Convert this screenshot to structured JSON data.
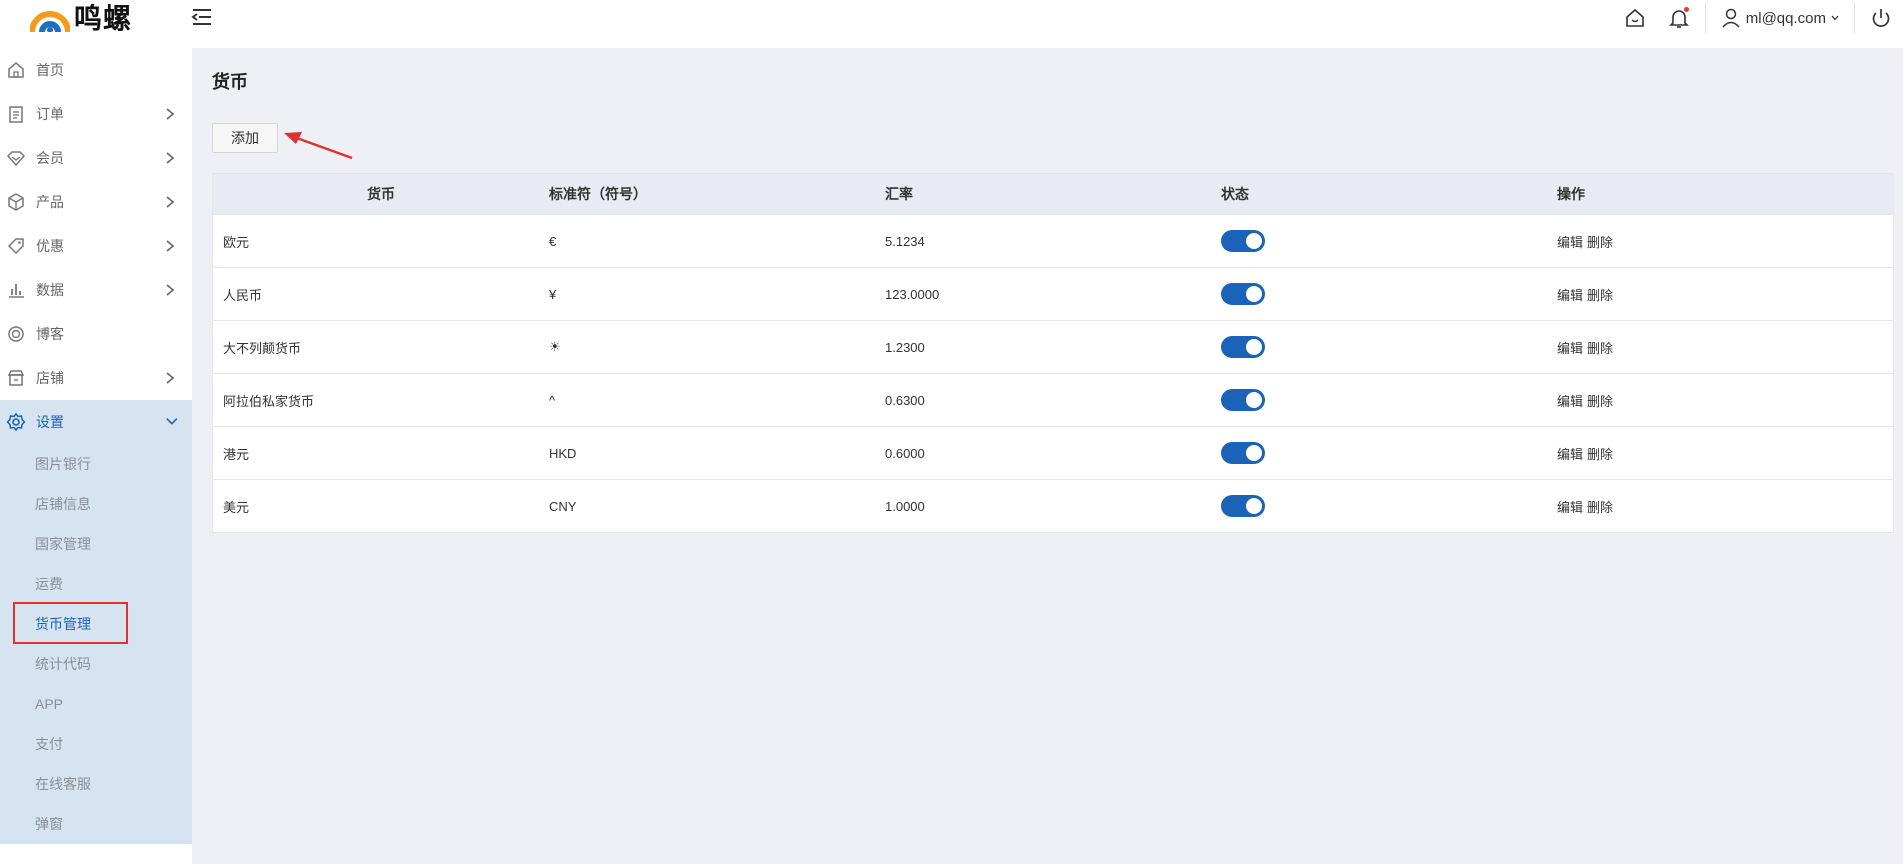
{
  "brand": {
    "name": "鸣螺"
  },
  "header": {
    "user_email": "ml@qq.com"
  },
  "sidebar": {
    "items": [
      {
        "label": "首页",
        "icon": "home-icon",
        "has_children": false
      },
      {
        "label": "订单",
        "icon": "order-icon",
        "has_children": true
      },
      {
        "label": "会员",
        "icon": "member-icon",
        "has_children": true
      },
      {
        "label": "产品",
        "icon": "product-icon",
        "has_children": true
      },
      {
        "label": "优惠",
        "icon": "tag-icon",
        "has_children": true
      },
      {
        "label": "数据",
        "icon": "chart-icon",
        "has_children": true
      },
      {
        "label": "博客",
        "icon": "blog-icon",
        "has_children": false
      },
      {
        "label": "店铺",
        "icon": "store-icon",
        "has_children": true
      },
      {
        "label": "设置",
        "icon": "gear-icon",
        "has_children": true,
        "expanded": true
      }
    ],
    "settings_children": [
      "图片银行",
      "店铺信息",
      "国家管理",
      "运费",
      "货币管理",
      "统计代码",
      "APP",
      "支付",
      "在线客服",
      "弹窗"
    ],
    "current_child": "货币管理"
  },
  "page": {
    "title": "货币",
    "add_label": "添加",
    "columns": [
      "货币",
      "标准符（符号）",
      "汇率",
      "状态",
      "操作"
    ],
    "rows": [
      {
        "currency": "欧元",
        "symbol": "€",
        "rate": "5.1234",
        "enabled": true
      },
      {
        "currency": "人民币",
        "symbol": "¥",
        "rate": "123.0000",
        "enabled": true
      },
      {
        "currency": "大不列颠货币",
        "symbol": "☀",
        "rate": "1.2300",
        "enabled": true
      },
      {
        "currency": "阿拉伯私家货币",
        "symbol": "^",
        "rate": "0.6300",
        "enabled": true
      },
      {
        "currency": "港元",
        "symbol": "HKD",
        "rate": "0.6000",
        "enabled": true
      },
      {
        "currency": "美元",
        "symbol": "CNY",
        "rate": "1.0000",
        "enabled": true
      }
    ],
    "edit_label": "编辑",
    "delete_label": "删除"
  },
  "colors": {
    "accent": "#1a63b8",
    "highlight": "#e03131",
    "sidebar_active_bg": "#d6e4f1"
  }
}
